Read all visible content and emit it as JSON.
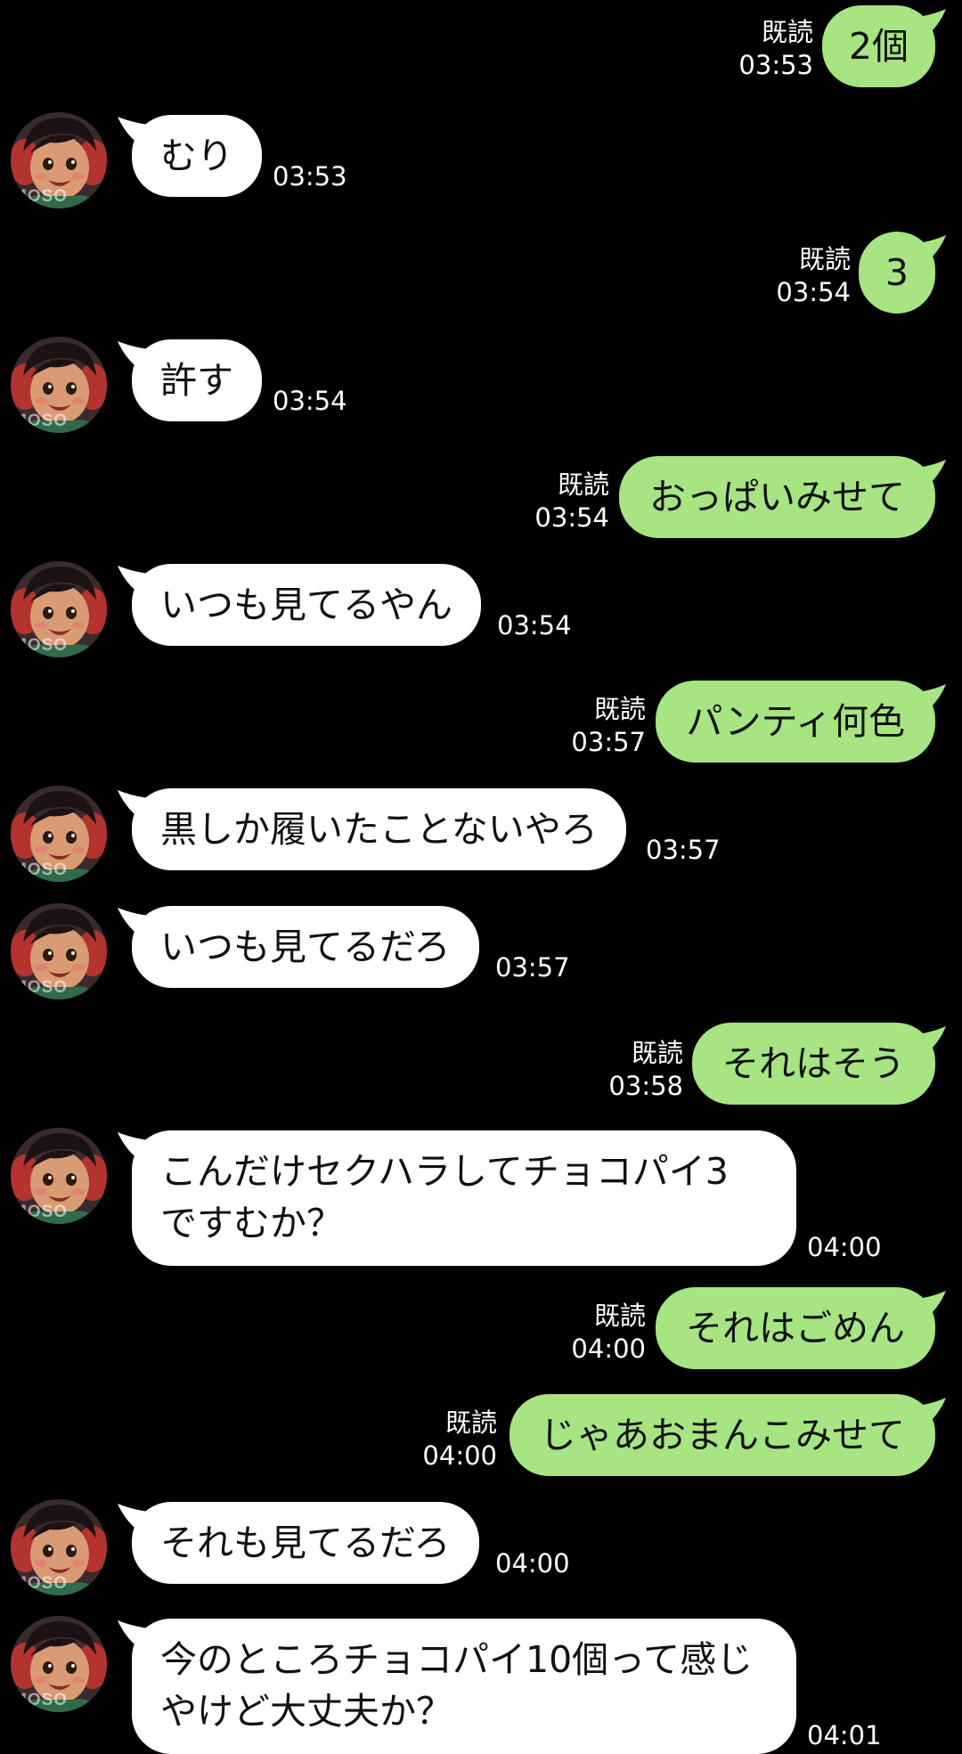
{
  "read_label": "既読",
  "contact": {
    "avatar_watermark": "MOSO"
  },
  "messages": [
    {
      "side": "out",
      "text": "2個",
      "time": "03:53",
      "read": "既読"
    },
    {
      "side": "in",
      "text": "むり",
      "time": "03:53"
    },
    {
      "side": "out",
      "text": "3",
      "time": "03:54",
      "read": "既読"
    },
    {
      "side": "in",
      "text": "許す",
      "time": "03:54"
    },
    {
      "side": "out",
      "text": "おっぱいみせて",
      "time": "03:54",
      "read": "既読"
    },
    {
      "side": "in",
      "text": "いつも見てるやん",
      "time": "03:54"
    },
    {
      "side": "out",
      "text": "パンティ何色",
      "time": "03:57",
      "read": "既読"
    },
    {
      "side": "in",
      "text": "黒しか履いたことないやろ",
      "time": "03:57"
    },
    {
      "side": "in",
      "text": "いつも見てるだろ",
      "time": "03:57"
    },
    {
      "side": "out",
      "text": "それはそう",
      "time": "03:58",
      "read": "既読"
    },
    {
      "side": "in",
      "lines": [
        "こんだけセクハラしてチョコパイ3",
        "ですむか？"
      ],
      "time": "04:00"
    },
    {
      "side": "out",
      "text": "それはごめん",
      "time": "04:00",
      "read": "既読"
    },
    {
      "side": "out",
      "text": "じゃあおまんこみせて",
      "time": "04:00",
      "read": "既読"
    },
    {
      "side": "in",
      "text": "それも見てるだろ",
      "time": "04:00"
    },
    {
      "side": "in",
      "lines": [
        "今のところチョコパイ10個って感じ",
        "やけど大丈夫か？"
      ],
      "time": "04:01"
    }
  ]
}
